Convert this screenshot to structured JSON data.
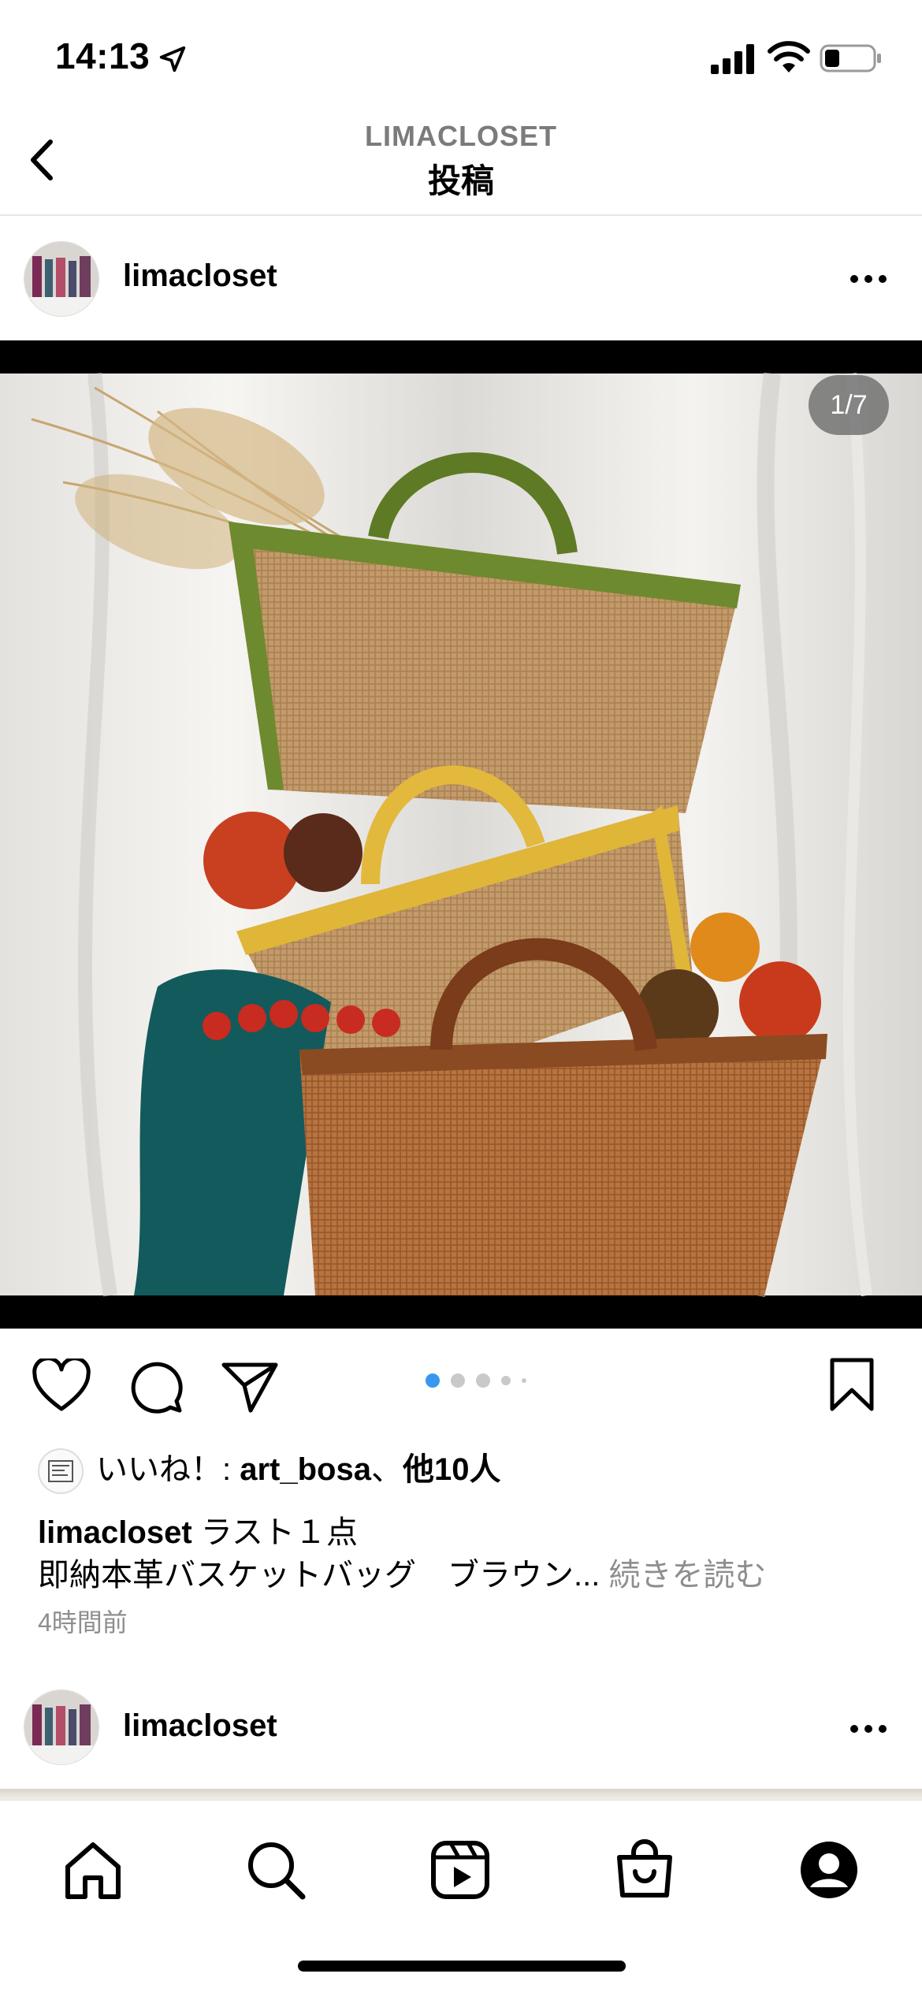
{
  "status_bar": {
    "time": "14:13"
  },
  "header": {
    "subtitle": "LIMACLOSET",
    "title": "投稿"
  },
  "post": {
    "username": "limacloset",
    "image_counter": "1/7",
    "carousel": {
      "current": 1,
      "visible_dots": 5
    },
    "likes": {
      "prefix": "いいね！: ",
      "liker": "art_bosa",
      "separator": "、",
      "others": "他10人"
    },
    "caption": {
      "username": "limacloset",
      "line1": " ラスト１点",
      "line2": "即納本革バスケットバッグ　ブラウン... ",
      "read_more": "続きを読む"
    },
    "time_ago": "4時間前"
  },
  "next_post": {
    "username": "limacloset"
  },
  "tab_bar": {
    "items": [
      "home-icon",
      "search-icon",
      "reels-icon",
      "shop-icon",
      "profile-icon"
    ]
  },
  "colors": {
    "accent_dot": "#3897f0",
    "muted": "#8e8e8e"
  }
}
